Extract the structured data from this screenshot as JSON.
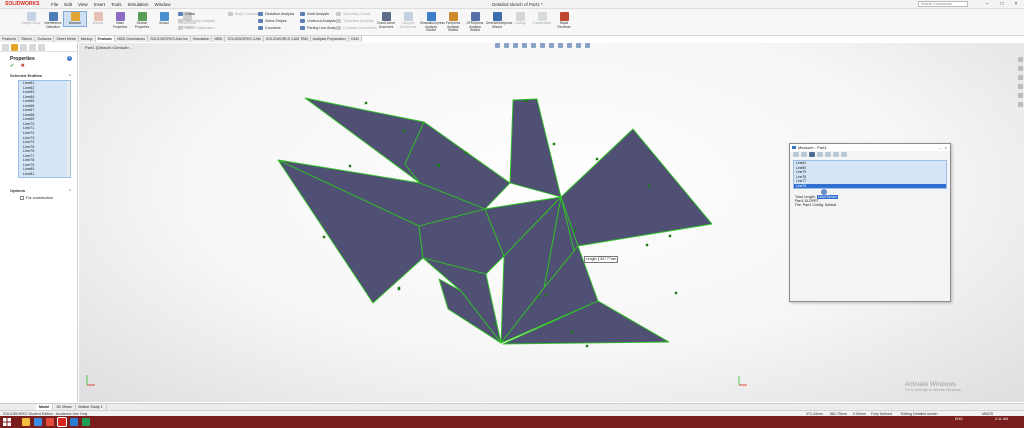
{
  "app": {
    "logo": "SOLIDWORKS",
    "menu": [
      "File",
      "Edit",
      "View",
      "Insert",
      "Tools",
      "Simulation",
      "Window"
    ],
    "doc_title": "Detailed sketch of Part1 *",
    "search_placeholder": "Search Commands"
  },
  "ribbon": {
    "big_commands": [
      {
        "label": "Design Study",
        "dim": true
      },
      {
        "label": "Interference Detection",
        "dim": false
      },
      {
        "label": "Measure",
        "dim": false,
        "selected": true
      },
      {
        "label": "Markup",
        "dim": true
      },
      {
        "label": "Mass Properties",
        "dim": false
      },
      {
        "label": "Section Properties",
        "dim": false
      },
      {
        "label": "Sensor",
        "dim": false
      },
      {
        "label": "Performance Evaluation",
        "dim": true
      },
      {
        "label": "Check Active Document",
        "dim": false
      },
      {
        "label": "Compare Documents",
        "dim": true
      },
      {
        "label": "SimulationXpress Analysis Wizard",
        "dim": false
      },
      {
        "label": "FloXpress Analysis Wizard",
        "dim": false
      },
      {
        "label": "DFMXpress Analysis Wizard",
        "dim": false
      },
      {
        "label": "DriveWorksXpress Wizard",
        "dim": false
      },
      {
        "label": "Costing",
        "dim": true
      },
      {
        "label": "Sustainability",
        "dim": true
      },
      {
        "label": "Rapid Reviewer",
        "dim": false
      }
    ],
    "small_commands": [
      {
        "label": "Check",
        "dim": false
      },
      {
        "label": "Geometry Analysis",
        "dim": true
      },
      {
        "label": "Import Diagnostics",
        "dim": true
      },
      {
        "label": "Body Compare",
        "dim": true
      },
      {
        "label": "Deviation Analysis",
        "dim": false
      },
      {
        "label": "Zebra Stripes",
        "dim": false
      },
      {
        "label": "Curvature",
        "dim": false
      },
      {
        "label": "Draft Analysis",
        "dim": false
      },
      {
        "label": "Undercut Analysis",
        "dim": false
      },
      {
        "label": "Parting Line Analysis",
        "dim": false
      },
      {
        "label": "Symmetry Check",
        "dim": true
      },
      {
        "label": "Thickness Analysis",
        "dim": true
      },
      {
        "label": "Compare Documents",
        "dim": true
      }
    ]
  },
  "tabs": [
    "Features",
    "Sketch",
    "Surfaces",
    "Sheet Metal",
    "Markup",
    "Evaluate",
    "MBD Dimensions",
    "SOLIDWORKS Add-Ins",
    "Simulation",
    "MBD",
    "SOLIDWORKS CAM",
    "SOLIDWORKS CAM TBM",
    "Analysis Preparation",
    "CAM"
  ],
  "active_tab": "Evaluate",
  "properties": {
    "title": "Properties",
    "help": "?",
    "ok": "✔",
    "cancel": "✖",
    "selected_title": "Selected Entities",
    "entities": [
      "Line61",
      "Line62",
      "Line63",
      "Line64",
      "Line65",
      "Line66",
      "Line67",
      "Line68",
      "Line69",
      "Line70",
      "Line71",
      "Line72",
      "Line73",
      "Line74",
      "Line75",
      "Line76",
      "Line77",
      "Line78",
      "Line79",
      "Line80",
      "Line81"
    ],
    "options_title": "Options",
    "for_construction": "For construction"
  },
  "viewport": {
    "breadcrumb": "Part1 (Default<<Default>...",
    "watermark_title": "Activate Windows",
    "watermark_sub": "Go to Settings to activate Windows.",
    "length_tip_label": "Length:",
    "length_tip_value": "807.77mm"
  },
  "measure": {
    "title": "Measure - Part1",
    "items": [
      "Line81",
      "Line80",
      "Line79",
      "Line78",
      "Line77",
      "Line76"
    ],
    "selected_index": 5,
    "total_length_label": "Total Length:",
    "total_length_value": "1849.51mm",
    "line2": "Part1.SLDPRT",
    "line3": "File: Part1 Config: Default"
  },
  "bottom_tabs": [
    "Model",
    "3D Views",
    "Motion Study 1"
  ],
  "status": {
    "left": "SOLIDWORKS Student Edition - Academic Use Only",
    "coord1": "471.44mm",
    "coord2": "581.75mm",
    "coord3": "0.00mm",
    "defined": "Fully Defined",
    "editing": "Editing Detailed sketch",
    "units": "MMGS"
  },
  "taskbar": {
    "time": "2:11 AM",
    "date": "2021-10-29",
    "lang": "ENG"
  },
  "colors": {
    "fill": "#4f5074",
    "edge": "#2fc423",
    "accent": "#d9261c",
    "taskbar": "#7a1d1d"
  }
}
